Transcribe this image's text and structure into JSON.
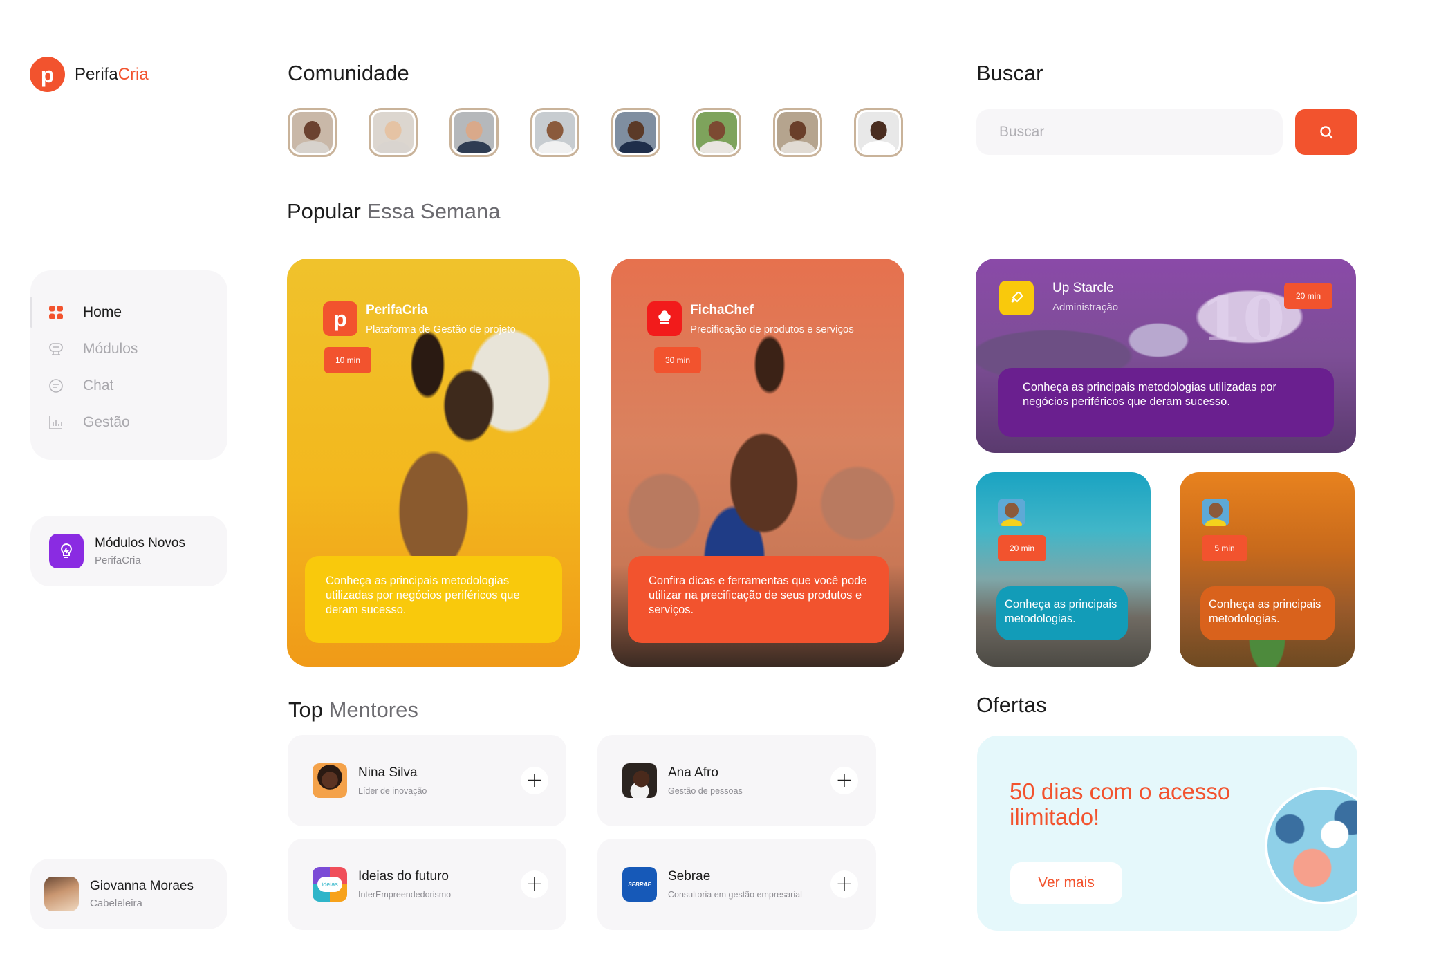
{
  "brand": {
    "mark": "p",
    "name_part1": "Perifa",
    "name_part2": "Cria",
    "color": "#f2532e"
  },
  "nav": {
    "items": [
      {
        "label": "Home",
        "icon": "grid-icon",
        "active": true
      },
      {
        "label": "Módulos",
        "icon": "modules-icon",
        "active": false
      },
      {
        "label": "Chat",
        "icon": "chat-icon",
        "active": false
      },
      {
        "label": "Gestão",
        "icon": "chart-icon",
        "active": false
      }
    ]
  },
  "modules_new": {
    "title": "Módulos Novos",
    "subtitle": "PerifaCria",
    "icon": "lightbulb-icon"
  },
  "profile": {
    "name": "Giovanna Moraes",
    "role": "Cabeleleira"
  },
  "community": {
    "title": "Comunidade",
    "members": [
      {
        "skin": "#6b4230",
        "shirt": "#d7d2cc",
        "bg": "#c9b8a8"
      },
      {
        "skin": "#e5c3a4",
        "shirt": "#d9d4cf",
        "bg": "#dcd6cf"
      },
      {
        "skin": "#d9a98a",
        "shirt": "#2f3c52",
        "bg": "#b5b8bb"
      },
      {
        "skin": "#8a5a3c",
        "shirt": "#f1f1f1",
        "bg": "#c7ccd0"
      },
      {
        "skin": "#5b3a28",
        "shirt": "#1f2e4a",
        "bg": "#7f8ea0"
      },
      {
        "skin": "#7c4a32",
        "shirt": "#e9e5e0",
        "bg": "#7ea35c"
      },
      {
        "skin": "#6a3f2a",
        "shirt": "#e1dbd3",
        "bg": "#b5a48e"
      },
      {
        "skin": "#4a2d20",
        "shirt": "#ffffff",
        "bg": "#e8e8e8"
      }
    ]
  },
  "search": {
    "title": "Buscar",
    "placeholder": "Buscar"
  },
  "popular": {
    "title": "Popular",
    "title_muted": "Essa Semana",
    "cards": [
      {
        "app": "PerifaCria",
        "subtitle": "Plataforma de Gestão de projeto",
        "badge": "10 min",
        "description": "Conheça as principais metodologias utilizadas por negócios periféricos que deram sucesso."
      },
      {
        "app": "FichaChef",
        "subtitle": "Precificação de produtos e serviços",
        "badge": "30 min",
        "description": "Confira dicas e ferramentas que você pode utilizar na precificação de seus produtos e serviços."
      }
    ]
  },
  "featured": {
    "app": "Up Starcle",
    "subtitle": "Administração",
    "badge": "20 min",
    "description": "Conheça as principais metodologias utilizadas por negócios periféricos que deram sucesso.",
    "jersey_number": "10"
  },
  "small_cards": [
    {
      "badge": "20 min",
      "description": "Conheça as principais metodologias."
    },
    {
      "badge": "5 min",
      "description": "Conheça as principais metodologias."
    }
  ],
  "mentors": {
    "title": "Top",
    "title_muted": "Mentores",
    "items": [
      {
        "name": "Nina Silva",
        "role": "Líder de inovação"
      },
      {
        "name": "Ana Afro",
        "role": "Gestão de pessoas"
      },
      {
        "name": "Ideias do futuro",
        "role": "InterEmpreendedorismo",
        "logo_text": "ideias"
      },
      {
        "name": "Sebrae",
        "role": "Consultoria em gestão empresarial",
        "logo_text": "SEBRAE"
      }
    ],
    "add_symbol": "+"
  },
  "offers": {
    "title": "Ofertas",
    "headline": "50 dias com o acesso ilimitado!",
    "button": "Ver mais"
  }
}
